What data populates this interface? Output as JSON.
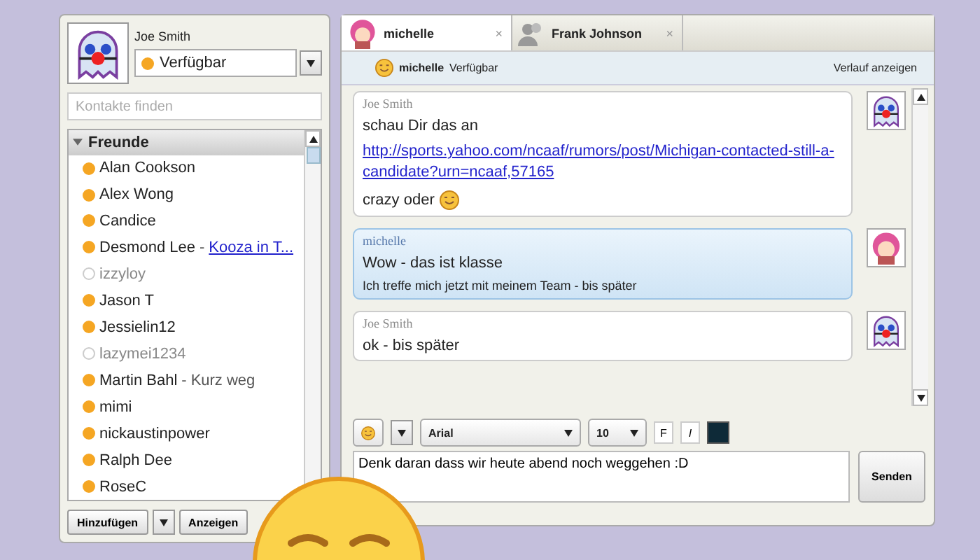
{
  "profile": {
    "name": "Joe Smith",
    "status": "Verfügbar"
  },
  "search": {
    "placeholder": "Kontakte finden"
  },
  "group": {
    "name": "Freunde",
    "expanded": true,
    "contacts": [
      {
        "name": "Alan Cookson",
        "online": true
      },
      {
        "name": "Alex Wong",
        "online": true
      },
      {
        "name": "Candice",
        "online": true
      },
      {
        "name": "Desmond Lee",
        "online": true,
        "separator": "-",
        "link_note": "Kooza in T..."
      },
      {
        "name": "izzyloy",
        "online": false
      },
      {
        "name": "Jason T",
        "online": true
      },
      {
        "name": "Jessielin12",
        "online": true
      },
      {
        "name": "lazymei1234",
        "online": false
      },
      {
        "name": "Martin Bahl",
        "online": true,
        "separator": "-",
        "note": "Kurz weg"
      },
      {
        "name": "mimi",
        "online": true
      },
      {
        "name": "nickaustinpower",
        "online": true
      },
      {
        "name": "Ralph Dee",
        "online": true
      },
      {
        "name": "RoseC",
        "online": true
      }
    ]
  },
  "contact_buttons": [
    "Hinzufügen",
    "Anzeigen"
  ],
  "tabs": [
    {
      "label": "michelle",
      "selected": true,
      "close": "×",
      "kind": "avatar"
    },
    {
      "label": "Frank Johnson",
      "selected": false,
      "close": "×",
      "kind": "placeholder"
    }
  ],
  "chat_header": {
    "name": "michelle",
    "status": "Verfügbar",
    "history": "Verlauf anzeigen"
  },
  "messages": [
    {
      "sender": "Joe Smith",
      "kind": "own",
      "lines": [
        {
          "kind": "text",
          "text": "schau Dir das an"
        },
        {
          "kind": "link",
          "text": "http://sports.yahoo.com/ncaaf/rumors/post/Michigan-contacted-still-a-candidate?urn=ncaaf,57165"
        },
        {
          "kind": "emoji",
          "text": "crazy oder"
        }
      ]
    },
    {
      "sender": "michelle",
      "kind": "other",
      "lines": [
        {
          "kind": "text",
          "text": "Wow - das ist klasse"
        },
        {
          "kind": "small",
          "text": "Ich treffe mich jetzt mit meinem Team - bis später"
        }
      ]
    },
    {
      "sender": "Joe Smith",
      "kind": "own",
      "lines": [
        {
          "kind": "text",
          "text": "ok - bis später"
        }
      ]
    }
  ],
  "format": {
    "font": "Arial",
    "size": "10",
    "bold": "F",
    "italic": "I"
  },
  "composer": {
    "value": "Denk daran dass wir heute abend noch weggehen :D"
  },
  "send": "Senden"
}
